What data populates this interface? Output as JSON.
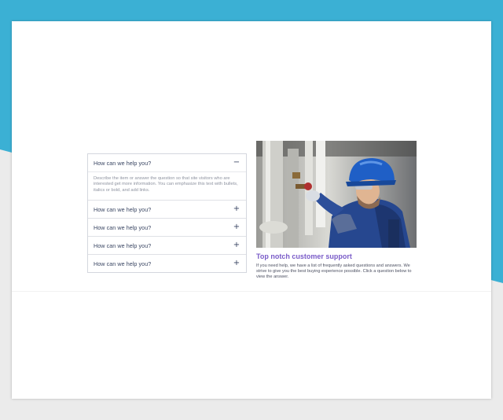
{
  "colors": {
    "top_band": "#3bb0d4",
    "page_bg": "#ebebeb",
    "card_bg": "#ffffff",
    "accent_title": "#7a5cc8",
    "faq_text": "#3a4663",
    "helmet_blue": "#1f5fc6"
  },
  "faq": {
    "items": [
      {
        "question": "How can we help you?",
        "toggle": "−",
        "answer": "Describe the item or answer the question so that site visitors who are interested get more information. You can emphasize this text with bullets, italics or bold, and add links."
      },
      {
        "question": "How can we help you?",
        "toggle": "+"
      },
      {
        "question": "How can we help you?",
        "toggle": "+"
      },
      {
        "question": "How can we help you?",
        "toggle": "+"
      },
      {
        "question": "How can we help you?",
        "toggle": "+"
      }
    ]
  },
  "support": {
    "title": "Top notch customer support",
    "text": "If you need help, we have a list of frequently asked questions and answers. We strive to give you the best buying experience possible. Click a question below to view the answer."
  }
}
